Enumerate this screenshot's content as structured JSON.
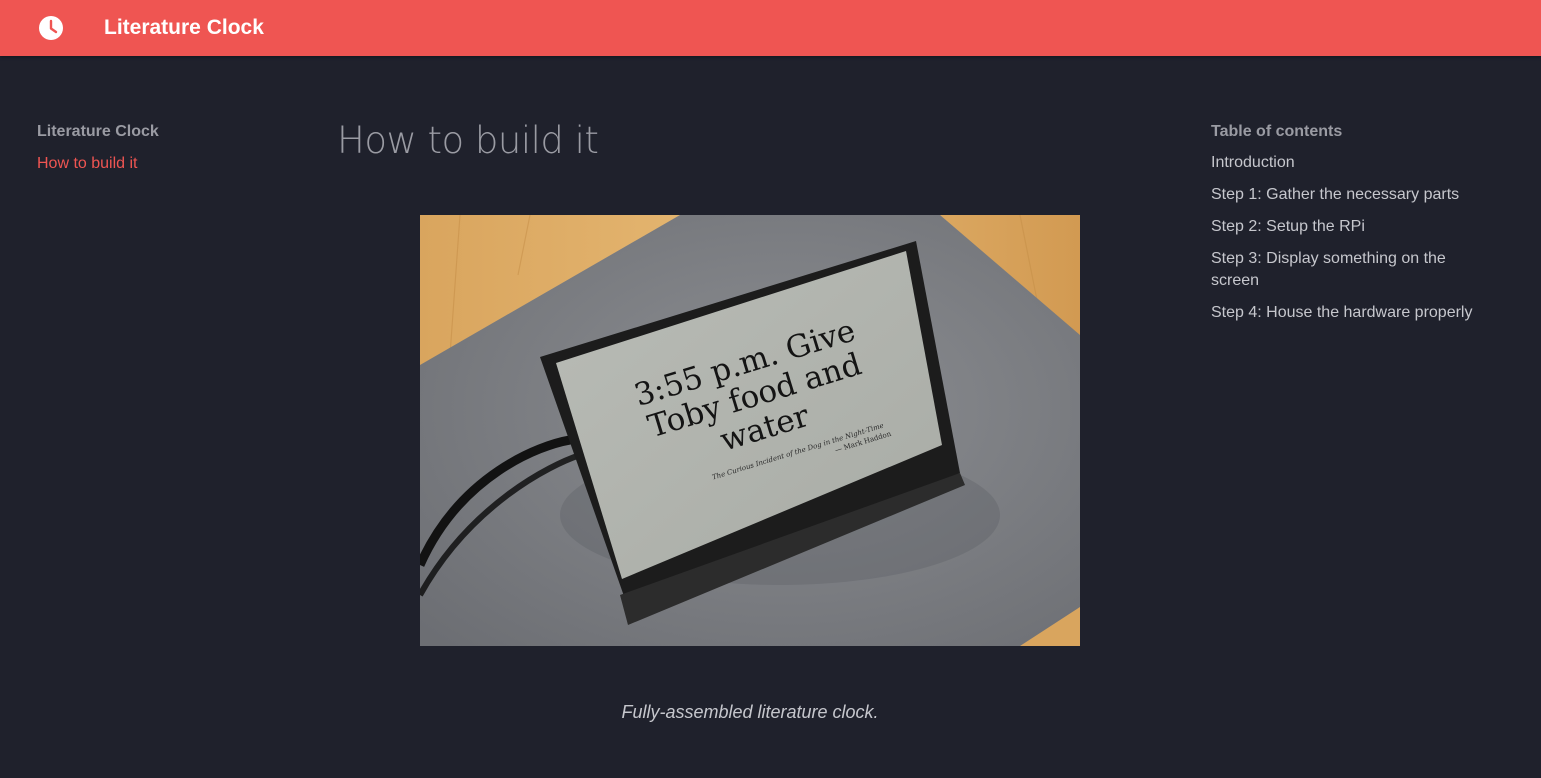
{
  "header": {
    "icon": "clock-icon",
    "title": "Literature Clock",
    "background_color": "#ef5552"
  },
  "sidebar": {
    "section_title": "Literature Clock",
    "items": [
      {
        "label": "How to build it",
        "active": true
      }
    ],
    "active_color": "#ef5552"
  },
  "main": {
    "title": "How to build it",
    "figure": {
      "screen_text_line1": "3:55 p.m. Give",
      "screen_text_line2": "Toby food and",
      "screen_text_line3": "water",
      "screen_source": "The Curious Incident of the Dog in the Night-Time",
      "screen_author": "— Mark Haddon",
      "caption": "Fully-assembled literature clock."
    }
  },
  "toc": {
    "title": "Table of contents",
    "items": [
      "Introduction",
      "Step 1: Gather the necessary parts",
      "Step 2: Setup the RPi",
      "Step 3: Display something on the screen",
      "Step 4: House the hardware properly"
    ]
  }
}
